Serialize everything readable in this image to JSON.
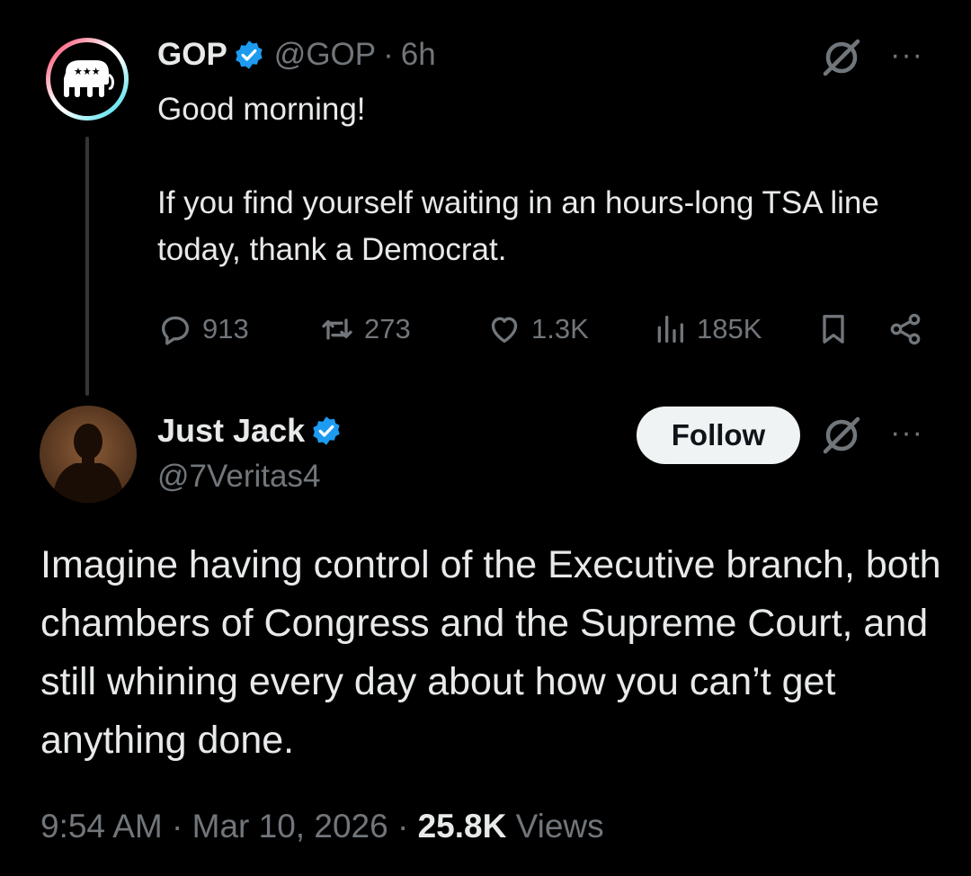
{
  "parent_tweet": {
    "author_name": "GOP",
    "handle": "@GOP",
    "separator": "·",
    "time": "6h",
    "text_paragraphs": [
      "Good morning!",
      "If you find yourself waiting in an hours-long TSA line today, thank a Democrat."
    ],
    "actions": {
      "replies": "913",
      "reposts": "273",
      "likes": "1.3K",
      "views": "185K"
    },
    "avatar_icon": "gop-elephant-icon",
    "avatar_ring_colors": [
      "#ff2d55",
      "#ffffff",
      "#25d8e8"
    ]
  },
  "reply_tweet": {
    "author_name": "Just Jack",
    "handle": "@7Veritas4",
    "follow_label": "Follow",
    "text": "Imagine having control of the Executive branch, both chambers of Congress and the Supreme Court, and still whining every day about how you can’t get anything done.",
    "meta": {
      "time": "9:54 AM",
      "sep1": "·",
      "date": "Mar 10, 2026",
      "sep2": "·",
      "views_count": "25.8K",
      "views_label": "Views"
    }
  },
  "icons": {
    "verified": "verified-badge-icon",
    "grok": "grok-icon",
    "more": "more-dots-icon",
    "reply": "reply-icon",
    "repost": "repost-icon",
    "like": "heart-icon",
    "views": "views-bars-icon",
    "bookmark": "bookmark-icon",
    "share": "share-icon"
  },
  "colors": {
    "background": "#000000",
    "text_primary": "#e7e9ea",
    "text_muted": "#71767b",
    "verified_blue": "#1d9bf0",
    "thread_line": "#333639",
    "follow_bg": "#eff3f4",
    "follow_text": "#0f1419"
  },
  "more_glyph": "···"
}
